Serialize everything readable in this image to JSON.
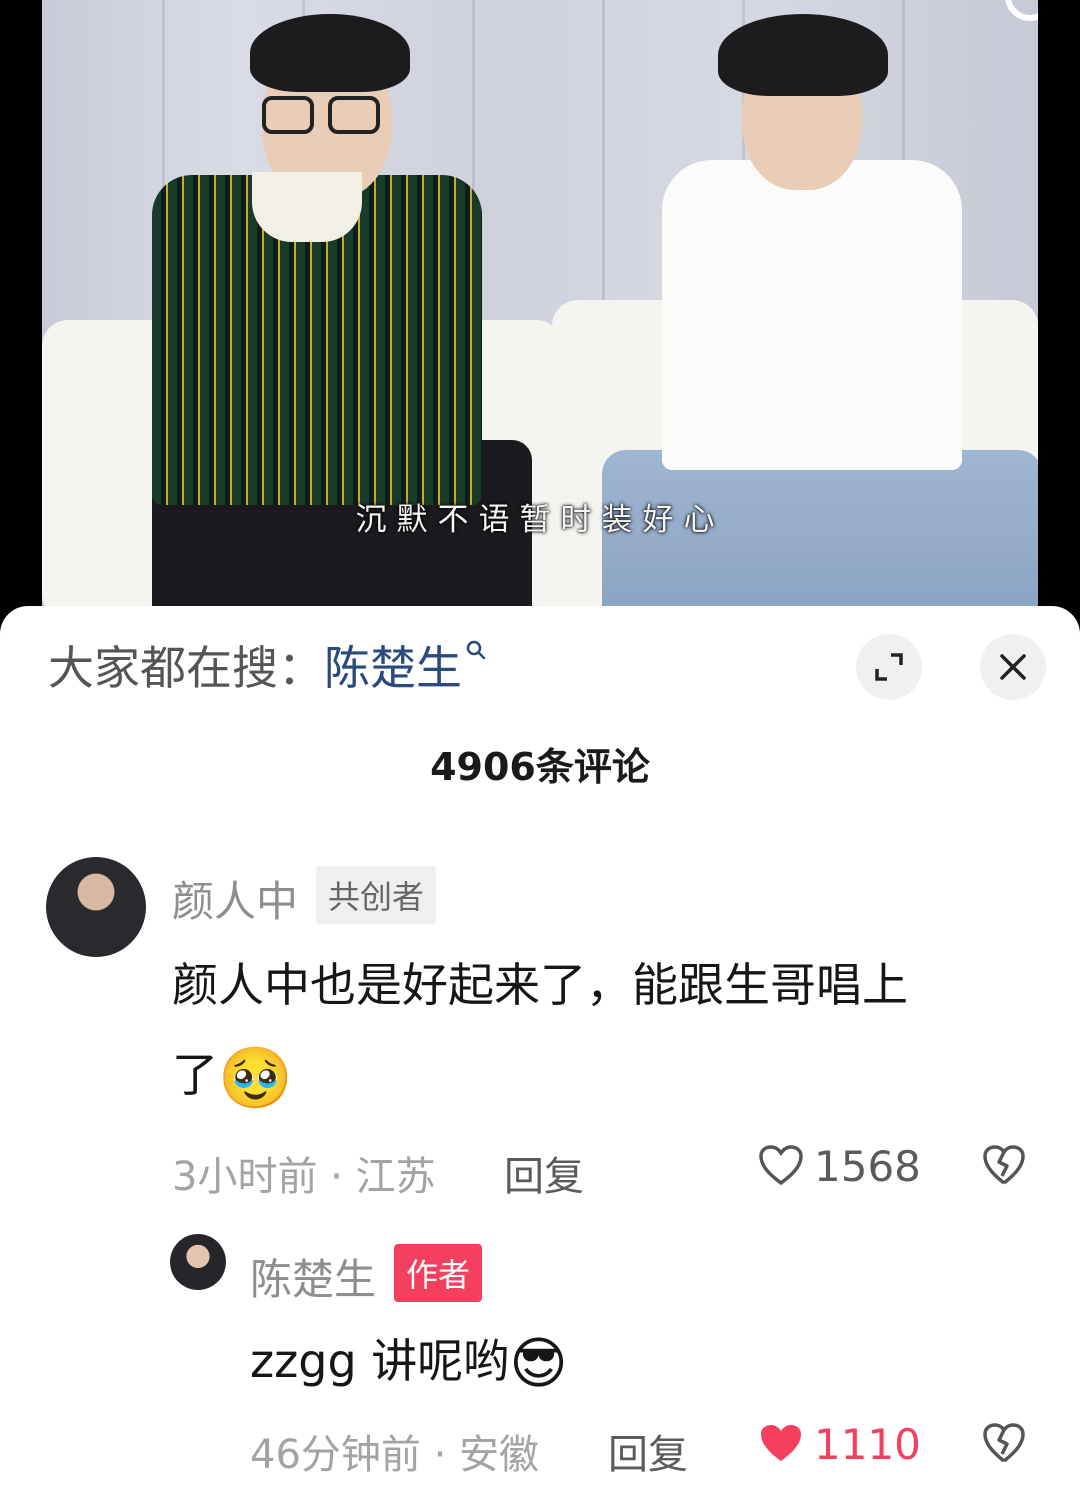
{
  "video": {
    "subtitle": "沉默不语暂时装好心"
  },
  "hot_search": {
    "prefix": "大家都在搜：",
    "keyword": "陈楚生"
  },
  "comments_header": {
    "count_label": "4906条评论"
  },
  "comments": [
    {
      "username": "颜人中",
      "badge": "共创者",
      "text_line1": "颜人中也是好起来了，能跟生哥唱上",
      "text_line2": "了",
      "emoji": "🥹",
      "time_location": "3小时前 · 江苏",
      "reply_label": "回复",
      "likes": "1568",
      "liked": false
    },
    {
      "username": "陈楚生",
      "badge": "作者",
      "text": "zzgg 讲呢哟",
      "emoji": "😎",
      "time_location": "46分钟前 · 安徽",
      "reply_label": "回复",
      "likes": "1110",
      "liked": true
    }
  ],
  "colors": {
    "like_active": "#f43f5e",
    "author_badge": "#f43f5e",
    "keyword": "#2a4a7c"
  },
  "icons": {
    "search": "search-icon",
    "expand": "expand-icon",
    "close": "close-icon",
    "heart": "heart-icon",
    "dislike": "broken-heart-icon"
  }
}
